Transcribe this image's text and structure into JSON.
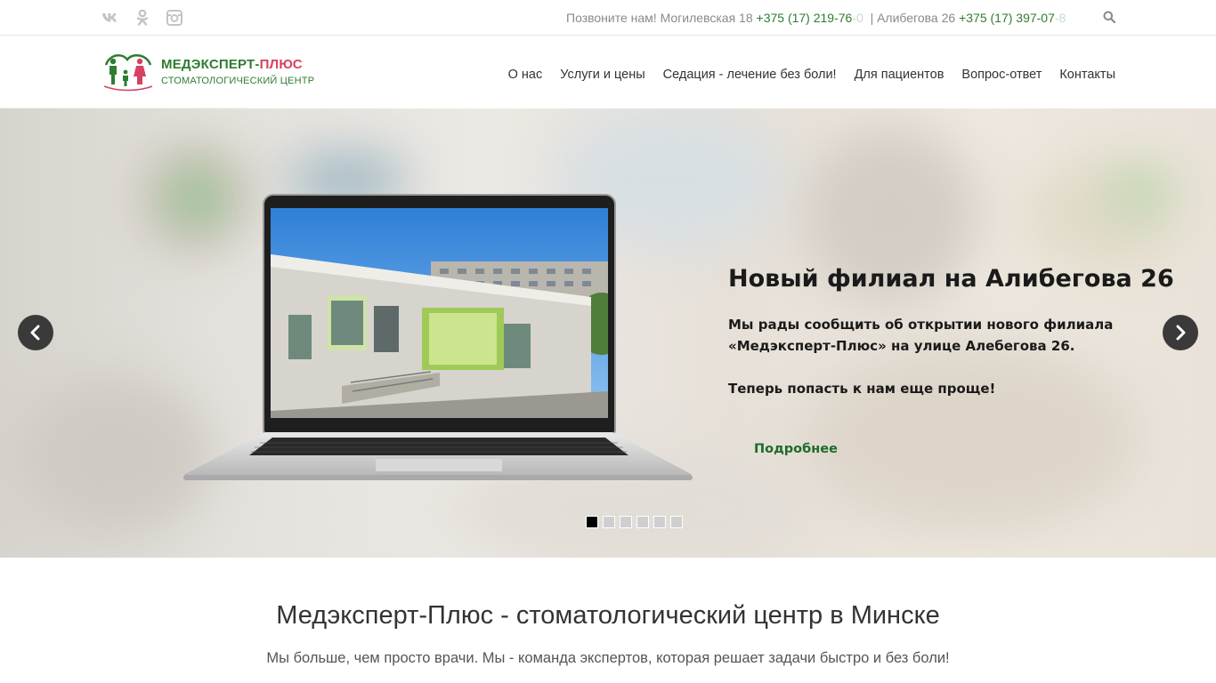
{
  "topbar": {
    "social": [
      {
        "name": "vk-icon",
        "label": "VK"
      },
      {
        "name": "odnoklassniki-icon",
        "label": "OK"
      },
      {
        "name": "instagram-icon",
        "label": "Instagram"
      }
    ],
    "call_text": "Позвоните нам!",
    "address1": "Могилевская 18",
    "phone1_main": "+375 (17) 219-76",
    "phone1_fade": "-0",
    "separator": "|",
    "address2": "Алибегова 26",
    "phone2_main": "+375 (17) 397-07",
    "phone2_fade": "-8",
    "search_icon": "search-icon"
  },
  "header": {
    "logo_name_main": "МЕДЭКСПЕРТ-",
    "logo_name_plus": "ПЛЮС",
    "logo_sub": "СТОМАТОЛОГИЧЕСКИЙ ЦЕНТР",
    "nav": [
      "О нас",
      "Услуги и цены",
      "Седация - лечение без боли!",
      "Для пациентов",
      "Вопрос-ответ",
      "Контакты"
    ]
  },
  "slider": {
    "title": "Новый филиал на Алибегова 26",
    "text_line1": "Мы рады сообщить об открытии нового филиала «Медэксперт-Плюс» на улице Алебегова 26.",
    "text_line2": "Теперь попасть к нам еще проще!",
    "more_label": "Подробнее",
    "dots_count": 6,
    "active_dot": 1,
    "prev_icon": "chevron-left-icon",
    "next_icon": "chevron-right-icon"
  },
  "intro": {
    "title": "Медэксперт-Плюс - стоматологический центр в Минске",
    "subtitle": "Мы больше, чем просто врачи. Мы - команда экспертов, которая решает задачи быстро и без боли!"
  },
  "colors": {
    "brand_green": "#2e7d32",
    "brand_pink": "#d6425f",
    "text_dark": "#333333"
  }
}
